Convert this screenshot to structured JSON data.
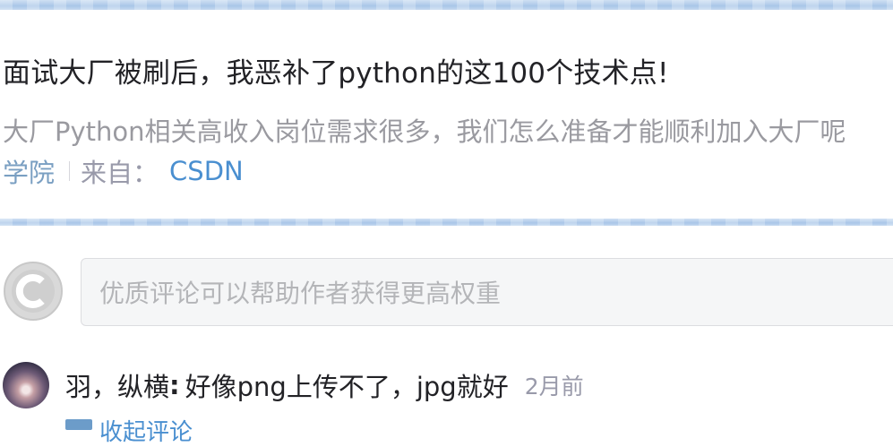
{
  "article": {
    "title": "面试大厂被刷后，我恶补了python的这100个技术点!",
    "description": "大厂Python相关高收入岗位需求很多，我们怎么准备才能顺利加入大厂呢",
    "category": "学院",
    "source_label": "来自：",
    "source_name": "CSDN"
  },
  "comment_input": {
    "placeholder": "优质评论可以帮助作者获得更高权重"
  },
  "comments": [
    {
      "user": "羽，纵横",
      "colon": ":",
      "text": "好像png上传不了，jpg就好",
      "time": "2月前"
    }
  ],
  "comment_actions": {
    "collapse_label": "收起评论"
  }
}
